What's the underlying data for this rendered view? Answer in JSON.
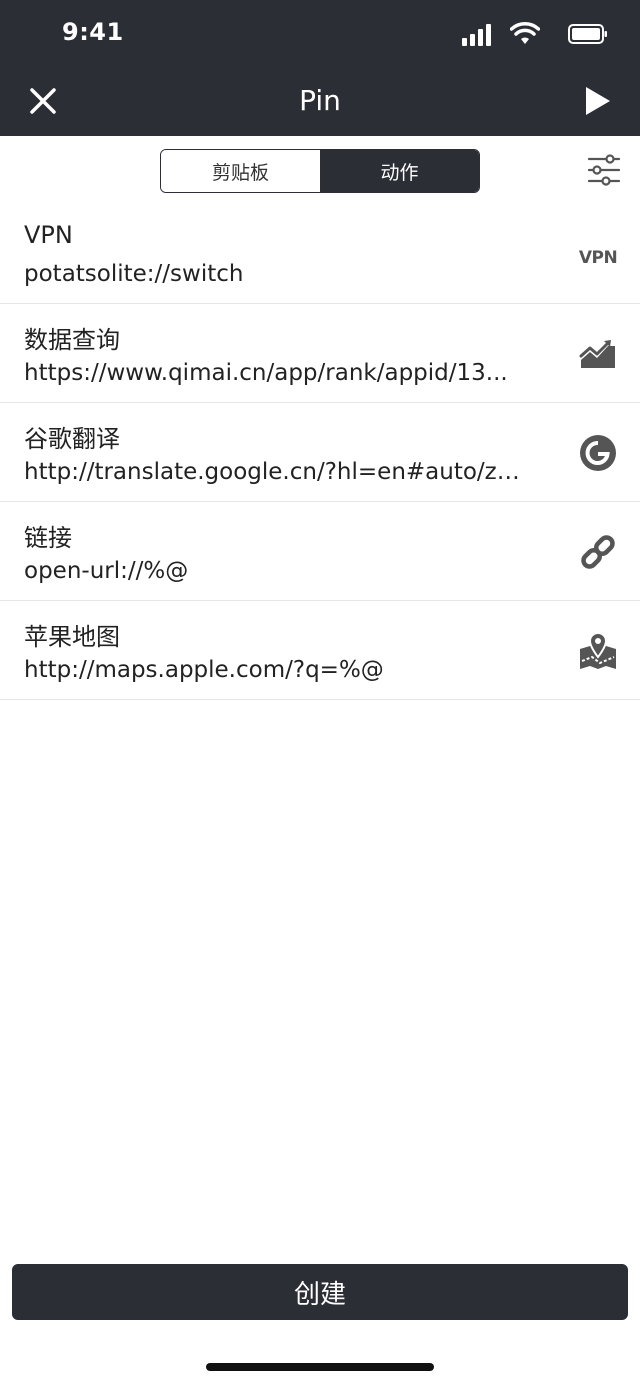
{
  "status_bar": {
    "time": "9:41"
  },
  "nav": {
    "title": "Pin"
  },
  "segments": [
    {
      "label": "剪贴板",
      "active": false
    },
    {
      "label": "动作",
      "active": true
    }
  ],
  "actions": [
    {
      "title": "VPN",
      "url": "potatsolite://switch",
      "icon": "vpn-icon"
    },
    {
      "title": "数据查询",
      "url": "https://www.qimai.cn/app/rank/appid/13...",
      "icon": "chart-icon"
    },
    {
      "title": "谷歌翻译",
      "url": "http://translate.google.cn/?hl=en#auto/zh...",
      "icon": "google-icon"
    },
    {
      "title": "链接",
      "url": "open-url://%@",
      "icon": "link-icon"
    },
    {
      "title": "苹果地图",
      "url": "http://maps.apple.com/?q=%@",
      "icon": "map-icon"
    }
  ],
  "footer": {
    "create_label": "创建"
  },
  "colors": {
    "header_bg": "#2b2e35",
    "icon_gray": "#555555"
  }
}
